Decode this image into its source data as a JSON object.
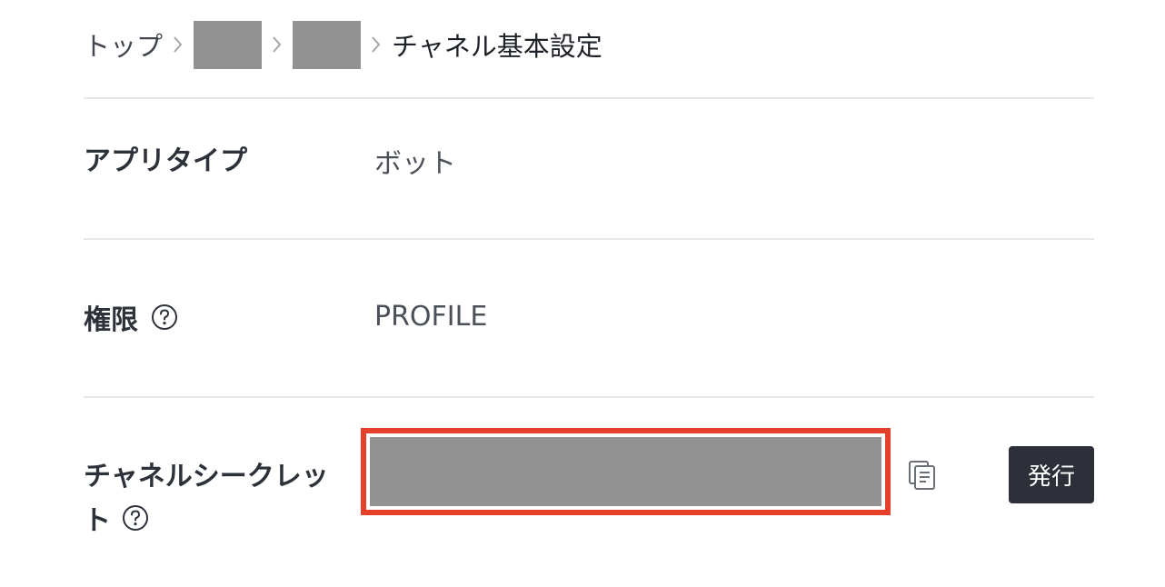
{
  "breadcrumb": {
    "items": [
      {
        "label": "トップ"
      },
      {
        "label": ""
      },
      {
        "label": ""
      }
    ],
    "current": "チャネル基本設定"
  },
  "settings": {
    "app_type": {
      "label": "アプリタイプ",
      "value": "ボット"
    },
    "permissions": {
      "label": "権限",
      "value": "PROFILE"
    },
    "channel_secret": {
      "label_line1": "チャネルシークレッ",
      "label_line2": "ト",
      "issue_label": "発行"
    }
  },
  "icons": [
    "chevron-right-icon",
    "help-icon",
    "copy-icon"
  ],
  "colors": {
    "highlight_border": "#e5402a",
    "redaction": "#929292",
    "issue_button_bg": "#2d3038"
  }
}
